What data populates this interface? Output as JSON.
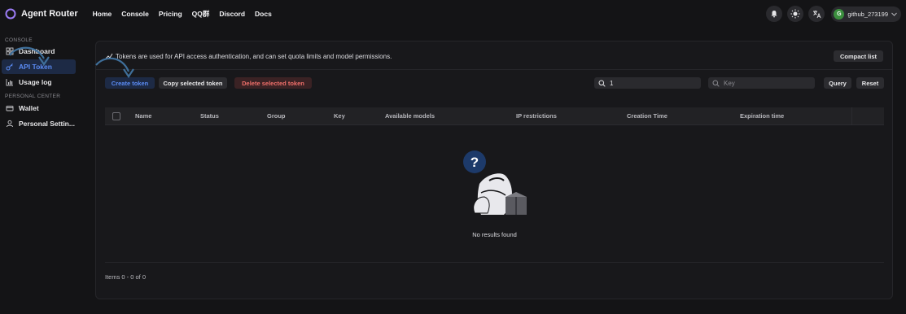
{
  "header": {
    "app_title": "Agent Router",
    "nav": [
      "Home",
      "Console",
      "Pricing",
      "QQ群",
      "Discord",
      "Docs"
    ],
    "user": {
      "avatar_letter": "G",
      "name": "github_273199"
    },
    "icons": [
      "bell-icon",
      "sun-icon",
      "translate-icon"
    ]
  },
  "sidebar": {
    "console_label": "CONSOLE",
    "items": [
      {
        "label": "Dashboard",
        "icon": "grid-icon"
      },
      {
        "label": "API Token",
        "icon": "key-icon",
        "active": true
      },
      {
        "label": "Usage log",
        "icon": "chart-icon"
      }
    ],
    "personal_label": "PERSONAL CENTER",
    "personal_items": [
      {
        "label": "Wallet",
        "icon": "wallet-icon"
      },
      {
        "label": "Personal Settin...",
        "icon": "user-icon"
      }
    ]
  },
  "main": {
    "description": "Tokens are used for API access authentication, and can set quota limits and model permissions.",
    "compact_button": "Compact list",
    "create_button": "Create token",
    "copy_button": "Copy selected token",
    "delete_button": "Delete selected token",
    "search_name_value": "1",
    "search_key_placeholder": "Key",
    "query_button": "Query",
    "reset_button": "Reset",
    "columns": [
      "Name",
      "Status",
      "Group",
      "Key",
      "Available models",
      "IP restrictions",
      "Creation Time",
      "Expiration time"
    ],
    "empty_text": "No results found",
    "pagination": "Items 0 - 0 of 0"
  },
  "colors": {
    "accent": "#5b8cf5",
    "danger": "#ef6f6a",
    "background": "#141416"
  }
}
